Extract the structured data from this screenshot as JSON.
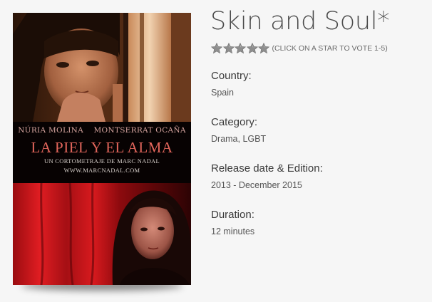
{
  "poster": {
    "actor_1": "NÚRIA MOLINA",
    "actor_2": "MONTSERRAT OCAÑA",
    "film_title": "LA PIEL Y EL ALMA",
    "credit": "UN CORTOMETRAJE DE MARC NADAL",
    "url": "WWW.MARCNADAL.COM"
  },
  "movie": {
    "title": "Skin and Soul*",
    "rating": {
      "stars_total": 5,
      "stars_filled": 5,
      "hint": "(CLICK ON A STAR TO VOTE 1-5)",
      "star_color": "#8e8e8e"
    },
    "fields": [
      {
        "label": "Country:",
        "value": "Spain"
      },
      {
        "label": "Category:",
        "value": "Drama, LGBT"
      },
      {
        "label": "Release date & Edition:",
        "value": "2013 - December 2015"
      },
      {
        "label": "Duration:",
        "value": "12 minutes"
      }
    ]
  }
}
